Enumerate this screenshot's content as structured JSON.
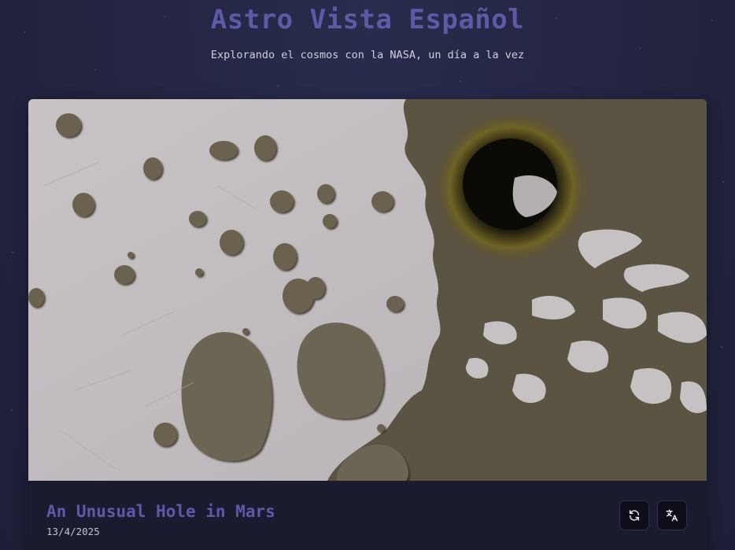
{
  "header": {
    "title": "Astro Vista Español",
    "subtitle": "Explorando el cosmos con la NASA, un día a la vez"
  },
  "apod": {
    "title": "An Unusual Hole in Mars",
    "date": "13/4/2025",
    "image_description": "Mars south polar surface with a dark pit hole surrounded by eroded pits"
  },
  "actions": {
    "refresh_icon": "refresh-icon",
    "translate_icon": "translate-icon"
  },
  "colors": {
    "background": "#232542",
    "accent": "#5e5aa8",
    "card": "#1a1b2f"
  }
}
